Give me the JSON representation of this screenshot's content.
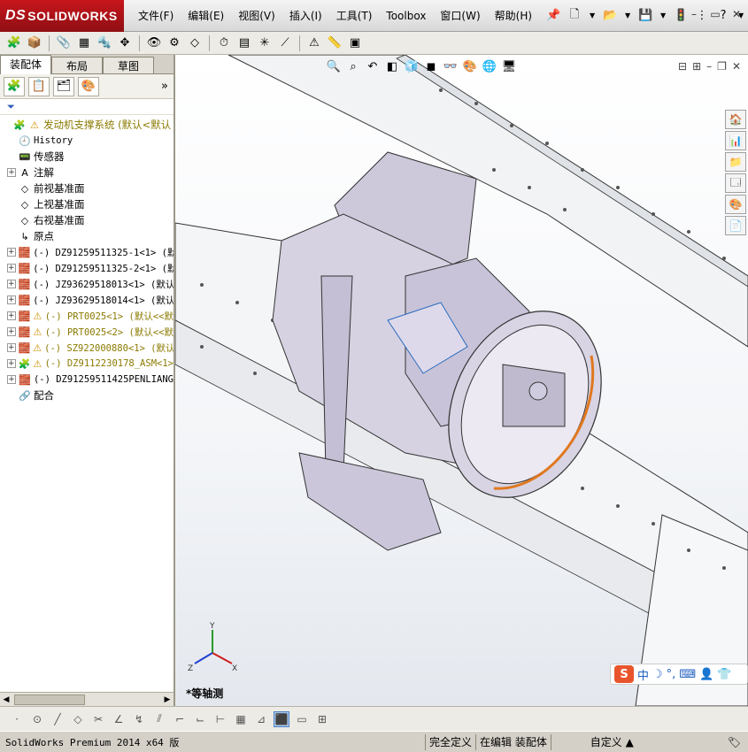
{
  "app": {
    "logo_text": "SOLIDWORKS",
    "logo_prefix": "DS"
  },
  "menu": {
    "items": [
      "文件(F)",
      "编辑(E)",
      "视图(V)",
      "插入(I)",
      "工具(T)",
      "Toolbox",
      "窗口(W)",
      "帮助(H)"
    ]
  },
  "left_panel": {
    "tabs": [
      "装配体",
      "布局",
      "草图"
    ],
    "active_tab": "装配体",
    "tree": [
      {
        "label": "发动机支撑系统  (默认<默认",
        "icon": "assembly-icon",
        "warning": true,
        "expand": "",
        "style": "root"
      },
      {
        "label": "History",
        "icon": "history-icon",
        "warning": false,
        "expand": "",
        "style": "mono"
      },
      {
        "label": "传感器",
        "icon": "sensor-icon",
        "warning": false,
        "expand": "",
        "style": "normal"
      },
      {
        "label": "注解",
        "icon": "annotation-icon",
        "warning": false,
        "expand": "+",
        "style": "normal"
      },
      {
        "label": "前视基准面",
        "icon": "plane-icon",
        "warning": false,
        "expand": "",
        "style": "normal"
      },
      {
        "label": "上视基准面",
        "icon": "plane-icon",
        "warning": false,
        "expand": "",
        "style": "normal"
      },
      {
        "label": "右视基准面",
        "icon": "plane-icon",
        "warning": false,
        "expand": "",
        "style": "normal"
      },
      {
        "label": "原点",
        "icon": "origin-icon",
        "warning": false,
        "expand": "",
        "style": "normal"
      },
      {
        "label": "(-) DZ91259511325-1<1> (默",
        "icon": "part-icon",
        "warning": false,
        "expand": "+",
        "style": "mono"
      },
      {
        "label": "(-) DZ91259511325-2<1> (默",
        "icon": "part-icon",
        "warning": false,
        "expand": "+",
        "style": "mono"
      },
      {
        "label": "(-) JZ93629518013<1> (默认",
        "icon": "part-icon",
        "warning": false,
        "expand": "+",
        "style": "mono"
      },
      {
        "label": "(-) JZ93629518014<1> (默认",
        "icon": "part-icon",
        "warning": false,
        "expand": "+",
        "style": "mono"
      },
      {
        "label": "(-) PRT0025<1> (默认<<默",
        "icon": "part-icon",
        "warning": true,
        "expand": "+",
        "style": "olive"
      },
      {
        "label": "(-) PRT0025<2> (默认<<默",
        "icon": "part-icon",
        "warning": true,
        "expand": "+",
        "style": "olive"
      },
      {
        "label": "(-) SZ922000880<1> (默认",
        "icon": "part-icon",
        "warning": true,
        "expand": "+",
        "style": "olive"
      },
      {
        "label": "(-) DZ9112230178_ASM<1>",
        "icon": "subassembly-icon",
        "warning": true,
        "expand": "+",
        "style": "olive"
      },
      {
        "label": "(-) DZ91259511425PENLIANG",
        "icon": "part-icon",
        "warning": false,
        "expand": "+",
        "style": "mono"
      },
      {
        "label": "配合",
        "icon": "mates-icon",
        "warning": false,
        "expand": "",
        "style": "normal"
      }
    ]
  },
  "viewport": {
    "view_label": "*等轴测",
    "triad": {
      "x": "X",
      "y": "Y",
      "z": "Z"
    },
    "ime_text": "中"
  },
  "status": {
    "app_version": "SolidWorks Premium 2014 x64 版",
    "definition": "完全定义",
    "mode": "在编辑 装配体",
    "custom": "自定义"
  },
  "colors": {
    "brand": "#c8161d",
    "accent_orange": "#e8552d",
    "part_lavender": "#c9c4d6",
    "frame_gray": "#eef0f2"
  }
}
